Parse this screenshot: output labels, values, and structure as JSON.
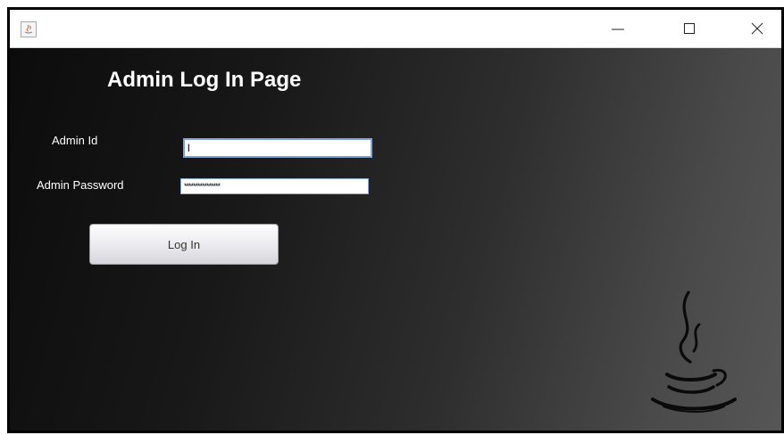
{
  "window": {
    "controls": {
      "minimize_icon": "minimize-icon",
      "maximize_icon": "maximize-icon",
      "close_icon": "close-icon"
    }
  },
  "form": {
    "title": "Admin Log In Page",
    "admin_id_label": "Admin Id",
    "admin_id_value": "l",
    "admin_password_label": "Admin Password",
    "admin_password_value": "****************",
    "login_button_label": "Log In"
  },
  "colors": {
    "background_dark": "#0c0c0c",
    "background_light": "#565656",
    "text": "#ffffff",
    "field_border": "#7fa4d4"
  }
}
